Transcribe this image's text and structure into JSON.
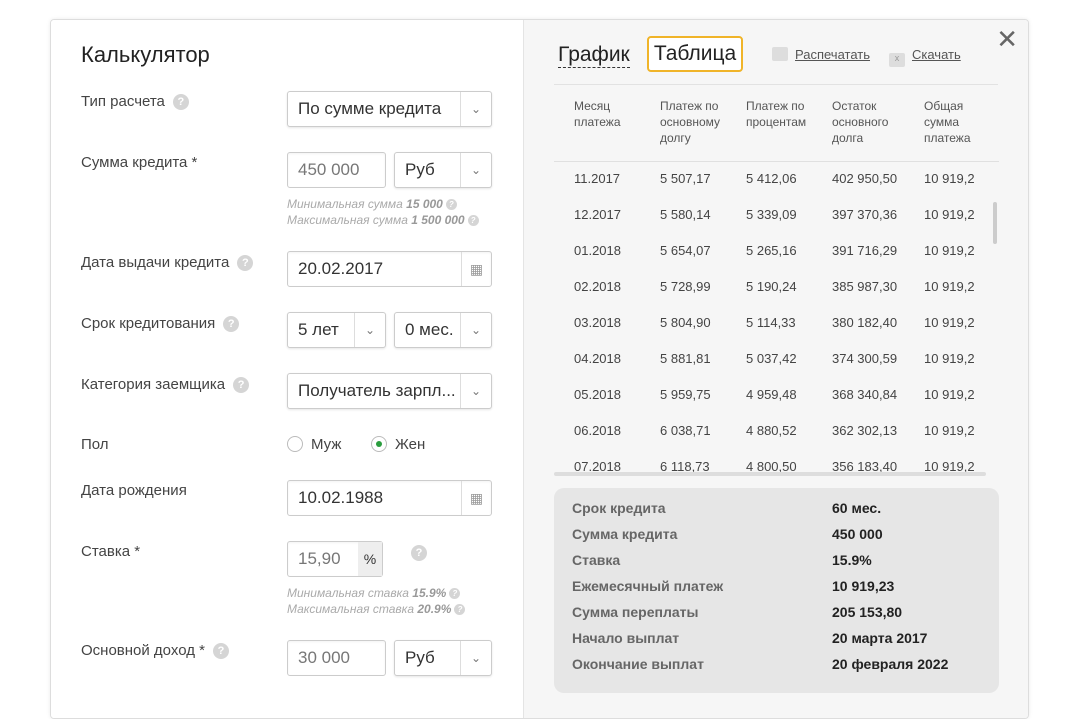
{
  "calc": {
    "title": "Калькулятор",
    "calc_type": {
      "label": "Тип расчета",
      "value": "По сумме кредита"
    },
    "amount": {
      "label": "Сумма кредита *",
      "value": "450 000",
      "currency": "Руб",
      "min_text": "Минимальная сумма",
      "min": "15 000",
      "max_text": "Максимальная сумма",
      "max": "1 500 000"
    },
    "issue_date": {
      "label": "Дата выдачи кредита",
      "value": "20.02.2017"
    },
    "term": {
      "label": "Срок кредитования",
      "years": "5 лет",
      "months": "0 мес."
    },
    "category": {
      "label": "Категория заемщика",
      "value": "Получатель зарпл..."
    },
    "gender": {
      "label": "Пол",
      "male": "Муж",
      "female": "Жен",
      "selected": "female"
    },
    "birth": {
      "label": "Дата рождения",
      "value": "10.02.1988"
    },
    "rate": {
      "label": "Ставка *",
      "value": "15,90",
      "unit": "%",
      "min_text": "Минимальная ставка",
      "min": "15.9%",
      "max_text": "Максимальная ставка",
      "max": "20.9%"
    },
    "income": {
      "label": "Основной доход *",
      "value": "30 000",
      "currency": "Руб"
    }
  },
  "results": {
    "tab_chart": "График",
    "tab_table": "Таблица",
    "print": "Распечатать",
    "download": "Скачать",
    "columns": [
      "Месяц платежа",
      "Платеж по основному долгу",
      "Платеж по процентам",
      "Остаток основного долга",
      "Общая сумма платежа"
    ],
    "rows": [
      [
        "11.2017",
        "5 507,17",
        "5 412,06",
        "402 950,50",
        "10 919,2"
      ],
      [
        "12.2017",
        "5 580,14",
        "5 339,09",
        "397 370,36",
        "10 919,2"
      ],
      [
        "01.2018",
        "5 654,07",
        "5 265,16",
        "391 716,29",
        "10 919,2"
      ],
      [
        "02.2018",
        "5 728,99",
        "5 190,24",
        "385 987,30",
        "10 919,2"
      ],
      [
        "03.2018",
        "5 804,90",
        "5 114,33",
        "380 182,40",
        "10 919,2"
      ],
      [
        "04.2018",
        "5 881,81",
        "5 037,42",
        "374 300,59",
        "10 919,2"
      ],
      [
        "05.2018",
        "5 959,75",
        "4 959,48",
        "368 340,84",
        "10 919,2"
      ],
      [
        "06.2018",
        "6 038,71",
        "4 880,52",
        "362 302,13",
        "10 919,2"
      ],
      [
        "07.2018",
        "6 118,73",
        "4 800,50",
        "356 183,40",
        "10 919,2"
      ]
    ],
    "summary": [
      {
        "label": "Срок кредита",
        "value": "60 мес."
      },
      {
        "label": "Сумма кредита",
        "value": "450 000"
      },
      {
        "label": "Ставка",
        "value": "15.9%"
      },
      {
        "label": "Ежемесячный платеж",
        "value": "10 919,23"
      },
      {
        "label": "Сумма переплаты",
        "value": "205 153,80"
      },
      {
        "label": "Начало выплат",
        "value": "20 марта 2017"
      },
      {
        "label": "Окончание выплат",
        "value": "20 февраля 2022"
      }
    ]
  }
}
